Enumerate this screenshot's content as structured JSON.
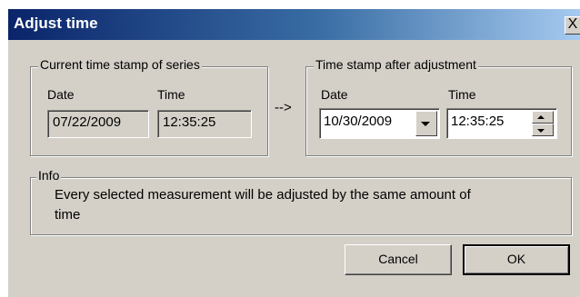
{
  "dialog": {
    "title": "Adjust time",
    "close_glyph": "X"
  },
  "current": {
    "legend": "Current time stamp of series",
    "date_label": "Date",
    "time_label": "Time",
    "date_value": "07/22/2009",
    "time_value": "12:35:25"
  },
  "arrow": "-->",
  "after": {
    "legend": "Time stamp after adjustment",
    "date_label": "Date",
    "time_label": "Time",
    "date_value": "10/30/2009",
    "time_value": "12:35:25"
  },
  "info": {
    "legend": "Info",
    "text_line1": "Every selected measurement will be adjusted by the same amount of",
    "text_line2": "time"
  },
  "buttons": {
    "cancel": "Cancel",
    "ok": "OK"
  },
  "icons": {
    "close": "close-icon",
    "dropdown": "chevron-down-icon",
    "spin_up": "spin-up-icon",
    "spin_down": "spin-down-icon"
  }
}
